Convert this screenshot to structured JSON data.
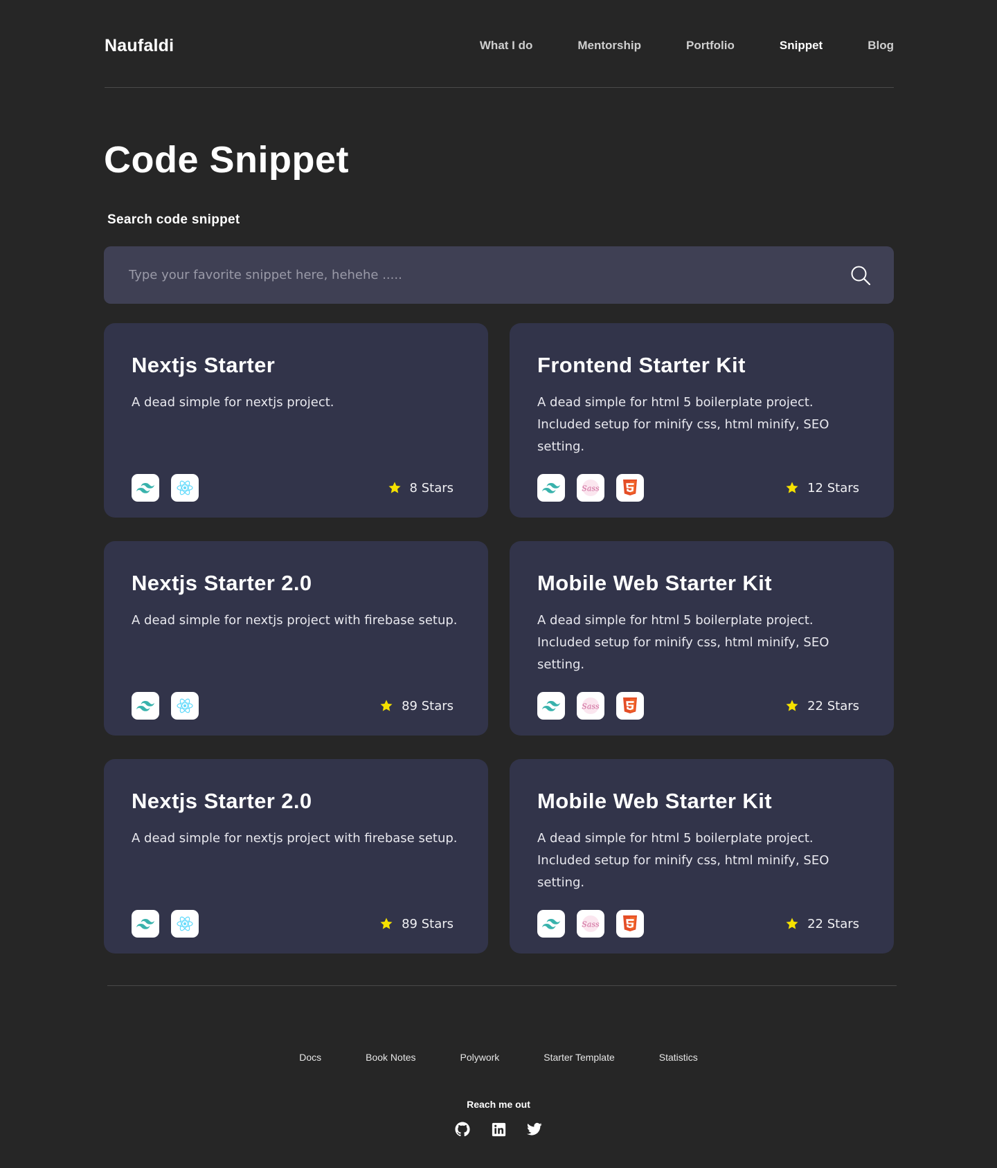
{
  "header": {
    "logo": "Naufaldi",
    "nav": [
      "What I do",
      "Mentorship",
      "Portfolio",
      "Snippet",
      "Blog"
    ],
    "active": "Snippet"
  },
  "page": {
    "title": "Code Snippet",
    "search_label": "Search code snippet",
    "search_placeholder": "Type your favorite snippet here, hehehe .....",
    "search_value": ""
  },
  "snippets": [
    {
      "title": "Nextjs Starter",
      "description": "A dead simple for nextjs project.",
      "stars": "8 Stars",
      "tech": [
        "tailwind-icon",
        "react-icon"
      ]
    },
    {
      "title": "Frontend Starter Kit",
      "description": "A dead simple for html 5 boilerplate project. Included setup for minify css, html minify, SEO setting.",
      "stars": "12 Stars",
      "tech": [
        "tailwind-icon",
        "sass-icon",
        "html5-icon"
      ]
    },
    {
      "title": "Nextjs Starter 2.0",
      "description": "A dead simple for nextjs project with firebase setup.",
      "stars": "89 Stars",
      "tech": [
        "tailwind-icon",
        "react-icon"
      ]
    },
    {
      "title": "Mobile Web Starter Kit",
      "description": "A dead simple for html 5 boilerplate project. Included setup for minify css, html minify, SEO setting.",
      "stars": "22 Stars",
      "tech": [
        "tailwind-icon",
        "sass-icon",
        "html5-icon"
      ]
    },
    {
      "title": "Nextjs Starter 2.0",
      "description": "A dead simple for nextjs project with firebase setup.",
      "stars": "89 Stars",
      "tech": [
        "tailwind-icon",
        "react-icon"
      ]
    },
    {
      "title": "Mobile Web Starter Kit",
      "description": "A dead simple for html 5 boilerplate project. Included setup for minify css, html minify, SEO setting.",
      "stars": "22 Stars",
      "tech": [
        "tailwind-icon",
        "sass-icon",
        "html5-icon"
      ]
    }
  ],
  "footer": {
    "links": [
      "Docs",
      "Book Notes",
      "Polywork",
      "Starter Template",
      "Statistics"
    ],
    "reach_label": "Reach me out",
    "socials": [
      "github-icon",
      "linkedin-icon",
      "twitter-icon"
    ]
  },
  "colors": {
    "background": "#262626",
    "card": "#32344a",
    "search": "#3f4054",
    "star": "#f5e100",
    "tailwind": "#38bdf8",
    "react": "#61dafb",
    "sass": "#cd6799",
    "html5": "#e44d26"
  }
}
